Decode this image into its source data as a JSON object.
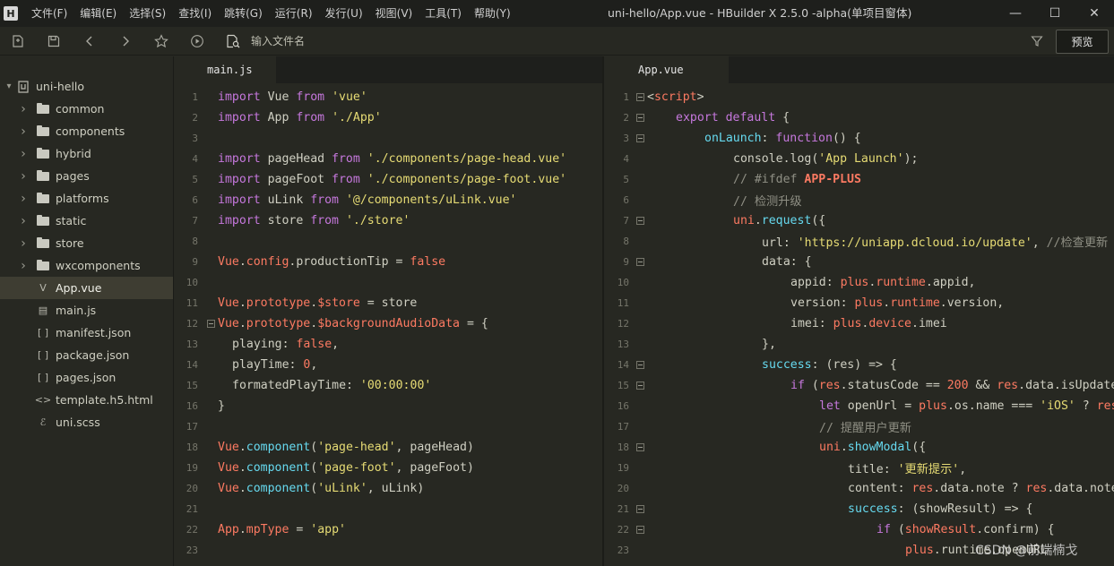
{
  "window": {
    "logo": "H",
    "title": "uni-hello/App.vue - HBuilder X 2.5.0 -alpha(单项目窗体)",
    "menus": [
      "文件(F)",
      "编辑(E)",
      "选择(S)",
      "查找(I)",
      "跳转(G)",
      "运行(R)",
      "发行(U)",
      "视图(V)",
      "工具(T)",
      "帮助(Y)"
    ],
    "controls": {
      "minimize": "—",
      "maximize": "☐",
      "close": "✕"
    }
  },
  "toolbar": {
    "file_input_placeholder": "输入文件名",
    "preview_label": "预览",
    "icons": [
      "new-file-icon",
      "save-icon",
      "back-icon",
      "forward-icon",
      "star-icon",
      "run-icon",
      "file-search-icon",
      "filter-icon"
    ]
  },
  "sidebar": {
    "project": "uni-hello",
    "items": [
      {
        "label": "common",
        "type": "folder"
      },
      {
        "label": "components",
        "type": "folder"
      },
      {
        "label": "hybrid",
        "type": "folder"
      },
      {
        "label": "pages",
        "type": "folder"
      },
      {
        "label": "platforms",
        "type": "folder"
      },
      {
        "label": "static",
        "type": "folder"
      },
      {
        "label": "store",
        "type": "folder"
      },
      {
        "label": "wxcomponents",
        "type": "folder"
      },
      {
        "label": "App.vue",
        "type": "vue",
        "active": true
      },
      {
        "label": "main.js",
        "type": "js"
      },
      {
        "label": "manifest.json",
        "type": "json"
      },
      {
        "label": "package.json",
        "type": "json"
      },
      {
        "label": "pages.json",
        "type": "json"
      },
      {
        "label": "template.h5.html",
        "type": "html"
      },
      {
        "label": "uni.scss",
        "type": "scss"
      }
    ],
    "icon_glyphs": {
      "vue": "V",
      "js": "▤",
      "json": "[ ]",
      "html": "<>",
      "scss": "ℰ"
    }
  },
  "editor_left": {
    "tab": "main.js",
    "lines": [
      {
        "n": "1",
        "indent": 0,
        "tokens": [
          [
            "kw",
            "import"
          ],
          [
            "plain",
            " Vue "
          ],
          [
            "kw",
            "from"
          ],
          [
            "plain",
            " "
          ],
          [
            "str",
            "'vue'"
          ]
        ]
      },
      {
        "n": "2",
        "indent": 0,
        "tokens": [
          [
            "kw",
            "import"
          ],
          [
            "plain",
            " App "
          ],
          [
            "kw",
            "from"
          ],
          [
            "plain",
            " "
          ],
          [
            "str",
            "'./App'"
          ]
        ]
      },
      {
        "n": "3",
        "indent": 0,
        "tokens": []
      },
      {
        "n": "4",
        "indent": 0,
        "tokens": [
          [
            "kw",
            "import"
          ],
          [
            "plain",
            " pageHead "
          ],
          [
            "kw",
            "from"
          ],
          [
            "plain",
            " "
          ],
          [
            "str",
            "'./components/page-head.vue'"
          ]
        ]
      },
      {
        "n": "5",
        "indent": 0,
        "tokens": [
          [
            "kw",
            "import"
          ],
          [
            "plain",
            " pageFoot "
          ],
          [
            "kw",
            "from"
          ],
          [
            "plain",
            " "
          ],
          [
            "str",
            "'./components/page-foot.vue'"
          ]
        ]
      },
      {
        "n": "6",
        "indent": 0,
        "tokens": [
          [
            "kw",
            "import"
          ],
          [
            "plain",
            " uLink "
          ],
          [
            "kw",
            "from"
          ],
          [
            "plain",
            " "
          ],
          [
            "str",
            "'@/components/uLink.vue'"
          ]
        ]
      },
      {
        "n": "7",
        "indent": 0,
        "tokens": [
          [
            "kw",
            "import"
          ],
          [
            "plain",
            " store "
          ],
          [
            "kw",
            "from"
          ],
          [
            "plain",
            " "
          ],
          [
            "str",
            "'./store'"
          ]
        ]
      },
      {
        "n": "8",
        "indent": 0,
        "tokens": []
      },
      {
        "n": "9",
        "indent": 0,
        "tokens": [
          [
            "obj",
            "Vue"
          ],
          [
            "plain",
            "."
          ],
          [
            "obj",
            "config"
          ],
          [
            "plain",
            ".productionTip = "
          ],
          [
            "bool",
            "false"
          ]
        ]
      },
      {
        "n": "10",
        "indent": 0,
        "tokens": []
      },
      {
        "n": "11",
        "indent": 0,
        "tokens": [
          [
            "obj",
            "Vue"
          ],
          [
            "plain",
            "."
          ],
          [
            "obj",
            "prototype"
          ],
          [
            "plain",
            "."
          ],
          [
            "obj",
            "$store"
          ],
          [
            "plain",
            " = store"
          ]
        ]
      },
      {
        "n": "12",
        "indent": 0,
        "fold": true,
        "tokens": [
          [
            "obj",
            "Vue"
          ],
          [
            "plain",
            "."
          ],
          [
            "obj",
            "prototype"
          ],
          [
            "plain",
            "."
          ],
          [
            "obj",
            "$backgroundAudioData"
          ],
          [
            "plain",
            " = {"
          ]
        ]
      },
      {
        "n": "13",
        "indent": 1,
        "tokens": [
          [
            "plain",
            "playing: "
          ],
          [
            "bool",
            "false"
          ],
          [
            "plain",
            ","
          ]
        ]
      },
      {
        "n": "14",
        "indent": 1,
        "tokens": [
          [
            "plain",
            "playTime: "
          ],
          [
            "num",
            "0"
          ],
          [
            "plain",
            ","
          ]
        ]
      },
      {
        "n": "15",
        "indent": 1,
        "tokens": [
          [
            "plain",
            "formatedPlayTime: "
          ],
          [
            "str",
            "'00:00:00'"
          ]
        ]
      },
      {
        "n": "16",
        "indent": 0,
        "tokens": [
          [
            "plain",
            "}"
          ]
        ]
      },
      {
        "n": "17",
        "indent": 0,
        "tokens": []
      },
      {
        "n": "18",
        "indent": 0,
        "tokens": [
          [
            "obj",
            "Vue"
          ],
          [
            "plain",
            "."
          ],
          [
            "fn",
            "component"
          ],
          [
            "plain",
            "("
          ],
          [
            "str",
            "'page-head'"
          ],
          [
            "plain",
            ", pageHead)"
          ]
        ]
      },
      {
        "n": "19",
        "indent": 0,
        "tokens": [
          [
            "obj",
            "Vue"
          ],
          [
            "plain",
            "."
          ],
          [
            "fn",
            "component"
          ],
          [
            "plain",
            "("
          ],
          [
            "str",
            "'page-foot'"
          ],
          [
            "plain",
            ", pageFoot)"
          ]
        ]
      },
      {
        "n": "20",
        "indent": 0,
        "tokens": [
          [
            "obj",
            "Vue"
          ],
          [
            "plain",
            "."
          ],
          [
            "fn",
            "component"
          ],
          [
            "plain",
            "("
          ],
          [
            "str",
            "'uLink'"
          ],
          [
            "plain",
            ", uLink)"
          ]
        ]
      },
      {
        "n": "21",
        "indent": 0,
        "tokens": []
      },
      {
        "n": "22",
        "indent": 0,
        "tokens": [
          [
            "obj",
            "App"
          ],
          [
            "plain",
            "."
          ],
          [
            "obj",
            "mpType"
          ],
          [
            "plain",
            " = "
          ],
          [
            "str",
            "'app'"
          ]
        ]
      },
      {
        "n": "23",
        "indent": 0,
        "tokens": []
      }
    ]
  },
  "editor_right": {
    "tab": "App.vue",
    "lines": [
      {
        "n": "1",
        "indent": 0,
        "fold": true,
        "tokens": [
          [
            "plain",
            "<"
          ],
          [
            "tag",
            "script"
          ],
          [
            "plain",
            ">"
          ]
        ]
      },
      {
        "n": "2",
        "indent": 1,
        "fold": true,
        "tokens": [
          [
            "kw",
            "export"
          ],
          [
            "plain",
            " "
          ],
          [
            "kw",
            "default"
          ],
          [
            "plain",
            " {"
          ]
        ]
      },
      {
        "n": "3",
        "indent": 2,
        "fold": true,
        "tokens": [
          [
            "fn",
            "onLaunch"
          ],
          [
            "plain",
            ": "
          ],
          [
            "kw",
            "function"
          ],
          [
            "plain",
            "() {"
          ]
        ]
      },
      {
        "n": "4",
        "indent": 3,
        "tokens": [
          [
            "plain",
            "console.log("
          ],
          [
            "str",
            "'App Launch'"
          ],
          [
            "plain",
            ");"
          ]
        ]
      },
      {
        "n": "5",
        "indent": 3,
        "tokens": [
          [
            "cmt",
            "// #ifdef "
          ],
          [
            "dir",
            "APP-PLUS"
          ]
        ]
      },
      {
        "n": "6",
        "indent": 3,
        "tokens": [
          [
            "cmt",
            "// 检测升级"
          ]
        ]
      },
      {
        "n": "7",
        "indent": 3,
        "fold": true,
        "tokens": [
          [
            "obj",
            "uni"
          ],
          [
            "plain",
            "."
          ],
          [
            "fn",
            "request"
          ],
          [
            "plain",
            "({"
          ]
        ]
      },
      {
        "n": "8",
        "indent": 4,
        "tokens": [
          [
            "plain",
            "url: "
          ],
          [
            "str",
            "'https://uniapp.dcloud.io/update'"
          ],
          [
            "plain",
            ", "
          ],
          [
            "cmt",
            "//检查更新"
          ]
        ]
      },
      {
        "n": "9",
        "indent": 4,
        "fold": true,
        "tokens": [
          [
            "plain",
            "data: {"
          ]
        ]
      },
      {
        "n": "10",
        "indent": 5,
        "tokens": [
          [
            "plain",
            "appid: "
          ],
          [
            "obj",
            "plus"
          ],
          [
            "plain",
            "."
          ],
          [
            "obj",
            "runtime"
          ],
          [
            "plain",
            ".appid,"
          ]
        ]
      },
      {
        "n": "11",
        "indent": 5,
        "tokens": [
          [
            "plain",
            "version: "
          ],
          [
            "obj",
            "plus"
          ],
          [
            "plain",
            "."
          ],
          [
            "obj",
            "runtime"
          ],
          [
            "plain",
            ".version,"
          ]
        ]
      },
      {
        "n": "12",
        "indent": 5,
        "tokens": [
          [
            "plain",
            "imei: "
          ],
          [
            "obj",
            "plus"
          ],
          [
            "plain",
            "."
          ],
          [
            "obj",
            "device"
          ],
          [
            "plain",
            ".imei"
          ]
        ]
      },
      {
        "n": "13",
        "indent": 4,
        "tokens": [
          [
            "plain",
            "},"
          ]
        ]
      },
      {
        "n": "14",
        "indent": 4,
        "fold": true,
        "tokens": [
          [
            "fn",
            "success"
          ],
          [
            "plain",
            ": (res) => {"
          ]
        ]
      },
      {
        "n": "15",
        "indent": 5,
        "fold": true,
        "tokens": [
          [
            "kw",
            "if"
          ],
          [
            "plain",
            " ("
          ],
          [
            "obj",
            "res"
          ],
          [
            "plain",
            ".statusCode == "
          ],
          [
            "num",
            "200"
          ],
          [
            "plain",
            " && "
          ],
          [
            "obj",
            "res"
          ],
          [
            "plain",
            ".data.isUpdate"
          ]
        ]
      },
      {
        "n": "16",
        "indent": 6,
        "tokens": [
          [
            "kw",
            "let"
          ],
          [
            "plain",
            " openUrl = "
          ],
          [
            "obj",
            "plus"
          ],
          [
            "plain",
            ".os.name === "
          ],
          [
            "str",
            "'iOS'"
          ],
          [
            "plain",
            " ? "
          ],
          [
            "obj",
            "res"
          ]
        ]
      },
      {
        "n": "17",
        "indent": 6,
        "tokens": [
          [
            "cmt",
            "// 提醒用户更新"
          ]
        ]
      },
      {
        "n": "18",
        "indent": 6,
        "fold": true,
        "tokens": [
          [
            "obj",
            "uni"
          ],
          [
            "plain",
            "."
          ],
          [
            "fn",
            "showModal"
          ],
          [
            "plain",
            "({"
          ]
        ]
      },
      {
        "n": "19",
        "indent": 7,
        "tokens": [
          [
            "plain",
            "title: "
          ],
          [
            "str",
            "'更新提示'"
          ],
          [
            "plain",
            ","
          ]
        ]
      },
      {
        "n": "20",
        "indent": 7,
        "tokens": [
          [
            "plain",
            "content: "
          ],
          [
            "obj",
            "res"
          ],
          [
            "plain",
            ".data.note ? "
          ],
          [
            "obj",
            "res"
          ],
          [
            "plain",
            ".data.note"
          ]
        ]
      },
      {
        "n": "21",
        "indent": 7,
        "fold": true,
        "tokens": [
          [
            "fn",
            "success"
          ],
          [
            "plain",
            ": (showResult) => {"
          ]
        ]
      },
      {
        "n": "22",
        "indent": 8,
        "fold": true,
        "tokens": [
          [
            "kw",
            "if"
          ],
          [
            "plain",
            " ("
          ],
          [
            "obj",
            "showResult"
          ],
          [
            "plain",
            ".confirm) {"
          ]
        ]
      },
      {
        "n": "23",
        "indent": 9,
        "tokens": [
          [
            "obj",
            "plus"
          ],
          [
            "plain",
            ".runtime.openURL"
          ]
        ]
      }
    ]
  },
  "watermark": "CSDN @前端楠戈"
}
